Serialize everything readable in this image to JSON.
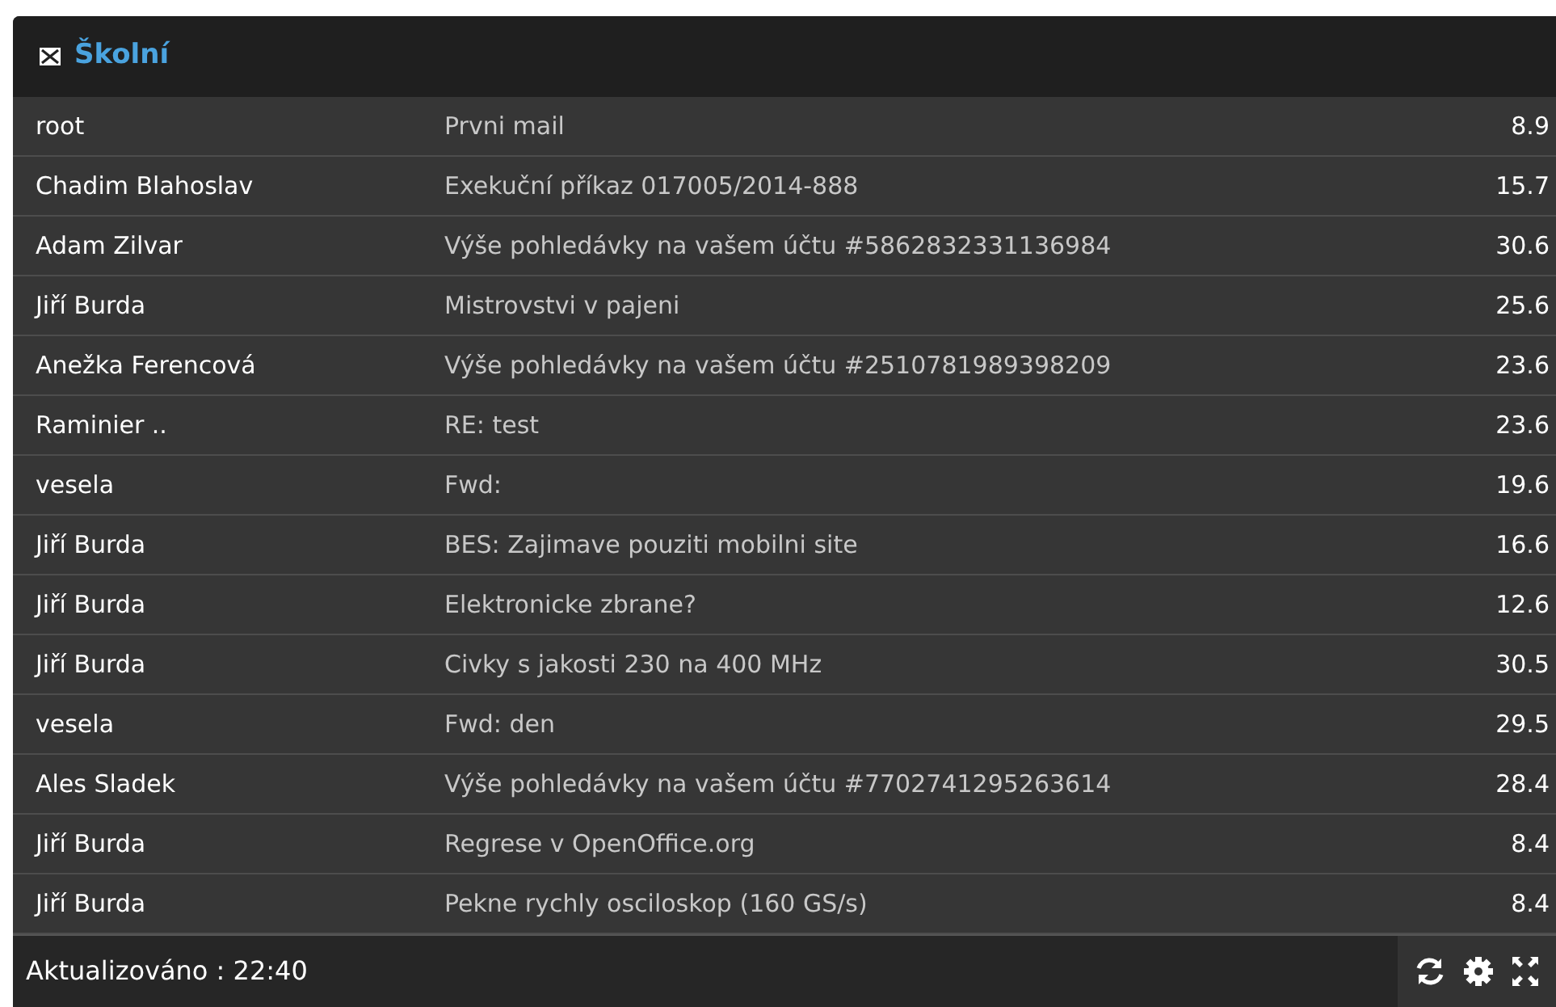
{
  "panel": {
    "title": "Školní"
  },
  "messages": [
    {
      "sender": "root",
      "subject": "Prvni mail",
      "size": "8.9"
    },
    {
      "sender": "Chadim Blahoslav",
      "subject": "Exekuční příkaz 017005/2014-888",
      "size": "15.7"
    },
    {
      "sender": "Adam Zilvar",
      "subject": "Výše pohledávky na vašem účtu #5862832331136984",
      "size": "30.6"
    },
    {
      "sender": "Jiří Burda",
      "subject": "Mistrovstvi v pajeni",
      "size": "25.6"
    },
    {
      "sender": "Anežka Ferencová",
      "subject": "Výše pohledávky na vašem účtu #2510781989398209",
      "size": "23.6"
    },
    {
      "sender": "Raminier ..",
      "subject": "RE: test",
      "size": "23.6"
    },
    {
      "sender": "vesela",
      "subject": "Fwd:",
      "size": "19.6"
    },
    {
      "sender": "Jiří Burda",
      "subject": "BES: Zajimave pouziti mobilni site",
      "size": "16.6"
    },
    {
      "sender": "Jiří Burda",
      "subject": "Elektronicke zbrane?",
      "size": "12.6"
    },
    {
      "sender": "Jiří Burda",
      "subject": "Civky s jakosti 230 na 400 MHz",
      "size": "30.5"
    },
    {
      "sender": "vesela",
      "subject": "Fwd: den",
      "size": "29.5"
    },
    {
      "sender": "Ales Sladek",
      "subject": "Výše pohledávky na vašem účtu #7702741295263614",
      "size": "28.4"
    },
    {
      "sender": "Jiří Burda",
      "subject": "Regrese v OpenOffice.org",
      "size": "8.4"
    },
    {
      "sender": "Jiří Burda",
      "subject": "Pekne rychly osciloskop (160 GS/s)",
      "size": "8.4"
    }
  ],
  "footer": {
    "updated": "Aktualizováno : 22:40"
  }
}
